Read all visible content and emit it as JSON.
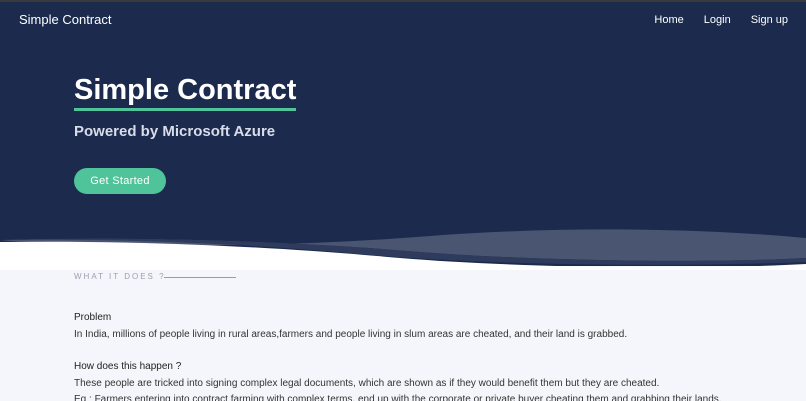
{
  "navbar": {
    "brand": "Simple Contract",
    "links": [
      "Home",
      "Login",
      "Sign up"
    ]
  },
  "hero": {
    "title": "Simple Contract",
    "subtitle": "Powered by Microsoft Azure",
    "cta_label": "Get Started"
  },
  "section": {
    "label": "WHAT IT DOES ?",
    "problem_heading": "Problem",
    "problem_text": "In India, millions of people living in rural areas,farmers and people living in slum areas are cheated, and their land is grabbed.",
    "how_heading": "How does this happen ?",
    "how_text": "These people are tricked into signing complex legal documents, which are shown as if they would benefit them but they are cheated.",
    "example_text": "Eg : Farmers entering into contract farming with complex terms, end up with the corporate or private buyer cheating them and grabbing their lands."
  },
  "colors": {
    "hero_bg": "#1b2a4d",
    "accent": "#4fc39a",
    "page_bg": "#f5f6fb"
  }
}
